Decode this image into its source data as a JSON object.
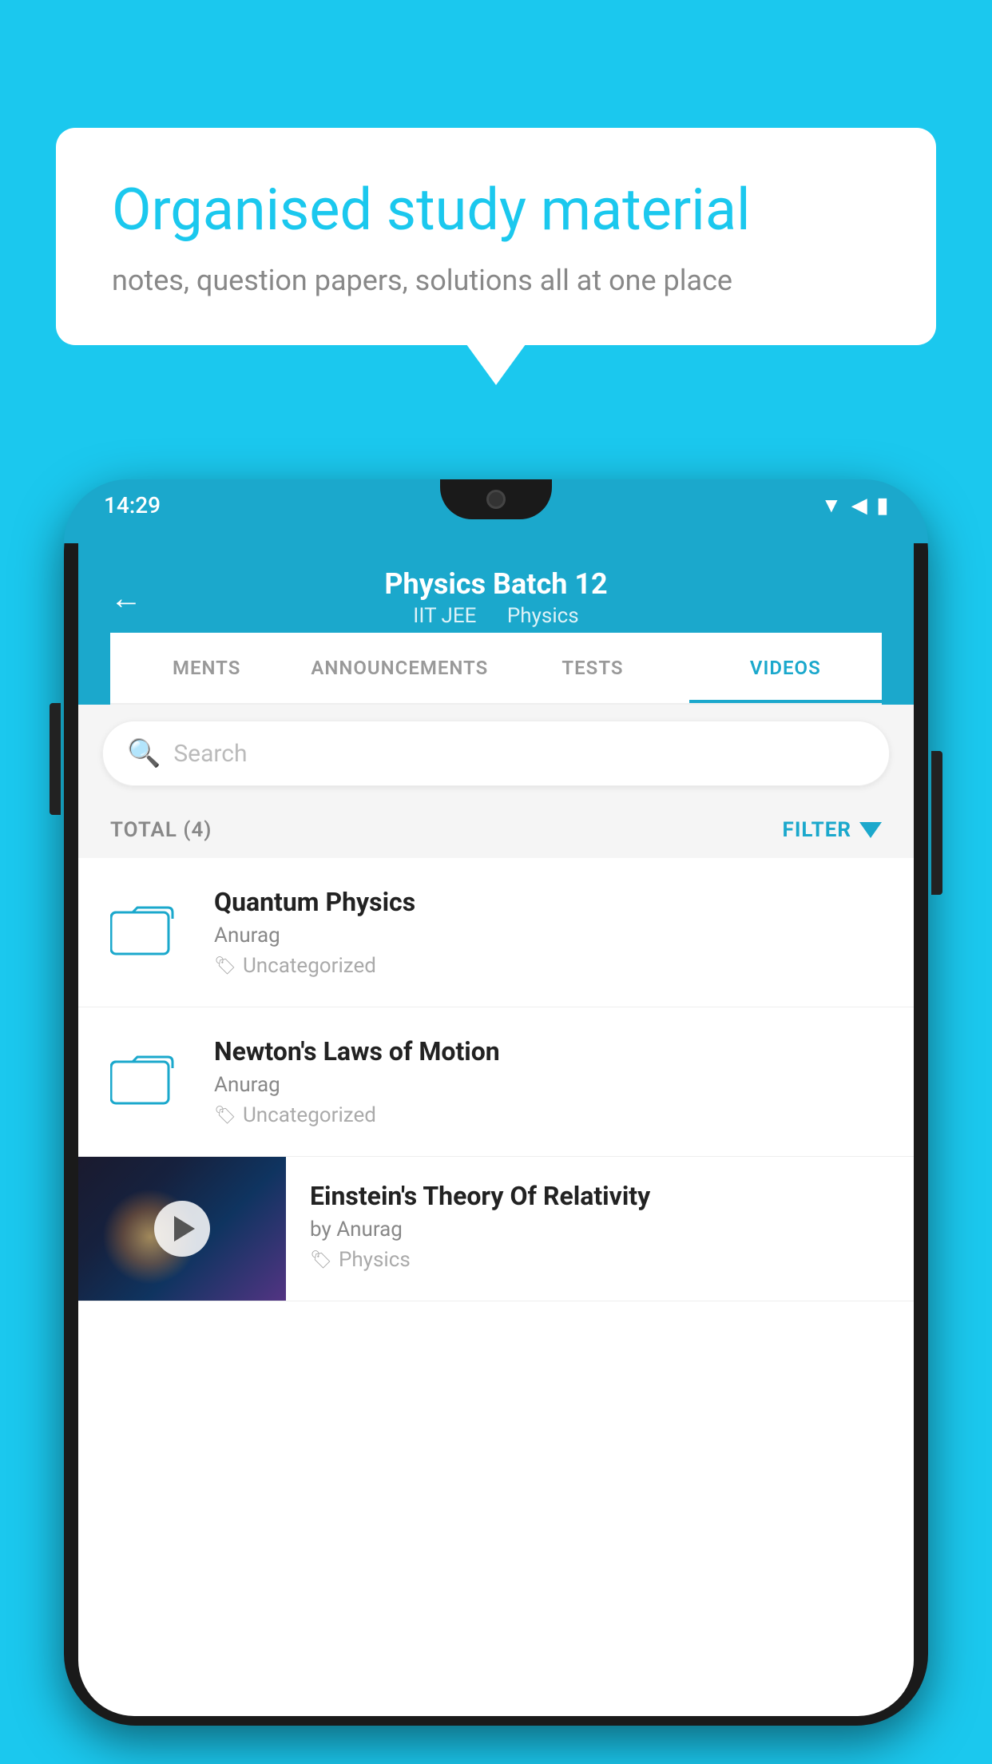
{
  "background_color": "#1BC8EE",
  "speech_bubble": {
    "title": "Organised study material",
    "subtitle": "notes, question papers, solutions all at one place"
  },
  "phone": {
    "status_bar": {
      "time": "14:29"
    },
    "header": {
      "title": "Physics Batch 12",
      "subtitle_part1": "IIT JEE",
      "subtitle_part2": "Physics",
      "back_label": "←"
    },
    "tabs": [
      {
        "label": "MENTS",
        "active": false
      },
      {
        "label": "ANNOUNCEMENTS",
        "active": false
      },
      {
        "label": "TESTS",
        "active": false
      },
      {
        "label": "VIDEOS",
        "active": true
      }
    ],
    "search": {
      "placeholder": "Search"
    },
    "filter": {
      "total_label": "TOTAL (4)",
      "filter_label": "FILTER"
    },
    "videos": [
      {
        "id": "quantum",
        "title": "Quantum Physics",
        "author": "Anurag",
        "tag": "Uncategorized",
        "type": "folder"
      },
      {
        "id": "newton",
        "title": "Newton's Laws of Motion",
        "author": "Anurag",
        "tag": "Uncategorized",
        "type": "folder"
      },
      {
        "id": "einstein",
        "title": "Einstein's Theory Of Relativity",
        "author": "by Anurag",
        "tag": "Physics",
        "type": "video"
      }
    ]
  }
}
